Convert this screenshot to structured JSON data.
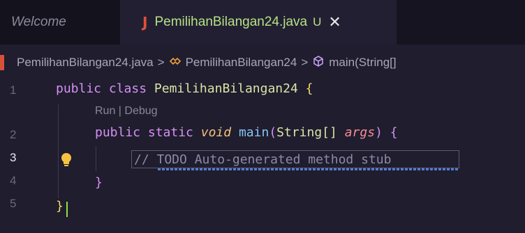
{
  "tabs": {
    "welcome": "Welcome",
    "active_icon": "J",
    "active_name": "PemilihanBilangan24.java",
    "active_status": "U",
    "close_glyph": "✕"
  },
  "breadcrumb": {
    "file": "PemilihanBilangan24.java",
    "separator": ">",
    "class_name": "PemilihanBilangan24",
    "method": "main(String[]",
    "class_icon": "class-symbol-icon",
    "method_icon": "method-cube-icon"
  },
  "code": {
    "line_numbers": [
      "1",
      "2",
      "3",
      "4",
      "5"
    ],
    "active_line": 3,
    "codelens": "Run | Debug",
    "line1": {
      "kw1": "public",
      "kw2": "class",
      "name": "PemilihanBilangan24",
      "brace": "{"
    },
    "line2": {
      "kw1": "public",
      "kw2": "static",
      "type": "void",
      "fn": "main",
      "open": "(",
      "ptype": "String[]",
      "param": "args",
      "close": ")",
      "brace": "{"
    },
    "line3": {
      "comment": "// TODO Auto-generated method stub"
    },
    "line4": {
      "brace": "}"
    },
    "line5": {
      "brace": "}"
    }
  },
  "colors": {
    "editor_bg": "#1f1d2e",
    "keyword": "#d690f2",
    "class_name": "#dbe4a6",
    "function": "#86c3f5",
    "parameter": "#f58c94",
    "comment": "#8d8aa6",
    "tab_modified": "#b7e283",
    "cursor": "#8fe04a"
  },
  "icons": {
    "lightbulb": "lightbulb-icon",
    "close": "close-icon"
  }
}
